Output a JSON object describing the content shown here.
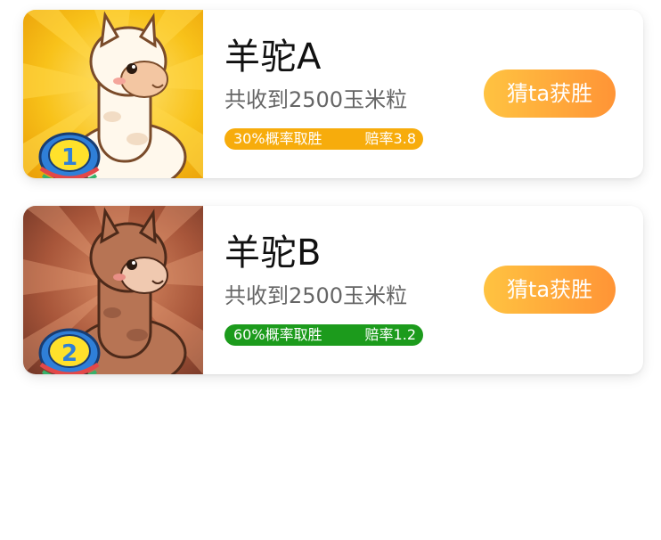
{
  "contestants": [
    {
      "name": "羊驼A",
      "received": "共收到2500玉米粒",
      "probability": "30%概率取胜",
      "odds": "赔率3.8",
      "button_label": "猜ta获胜",
      "badge_number": "1",
      "badge_color": "#f7ac0c",
      "background": "#f3b40a",
      "alpaca_color": "#fff8ec"
    },
    {
      "name": "羊驼B",
      "received": "共收到2500玉米粒",
      "probability": "60%概率取胜",
      "odds": "赔率1.2",
      "button_label": "猜ta获胜",
      "badge_number": "2",
      "badge_color": "#1c9b1c",
      "background": "#8c4a32",
      "alpaca_color": "#b77454"
    }
  ],
  "colors": {
    "button_gradient_start": "#ffc341",
    "button_gradient_end": "#ff9436",
    "title_text": "#111111",
    "subtitle_text": "#666666"
  }
}
